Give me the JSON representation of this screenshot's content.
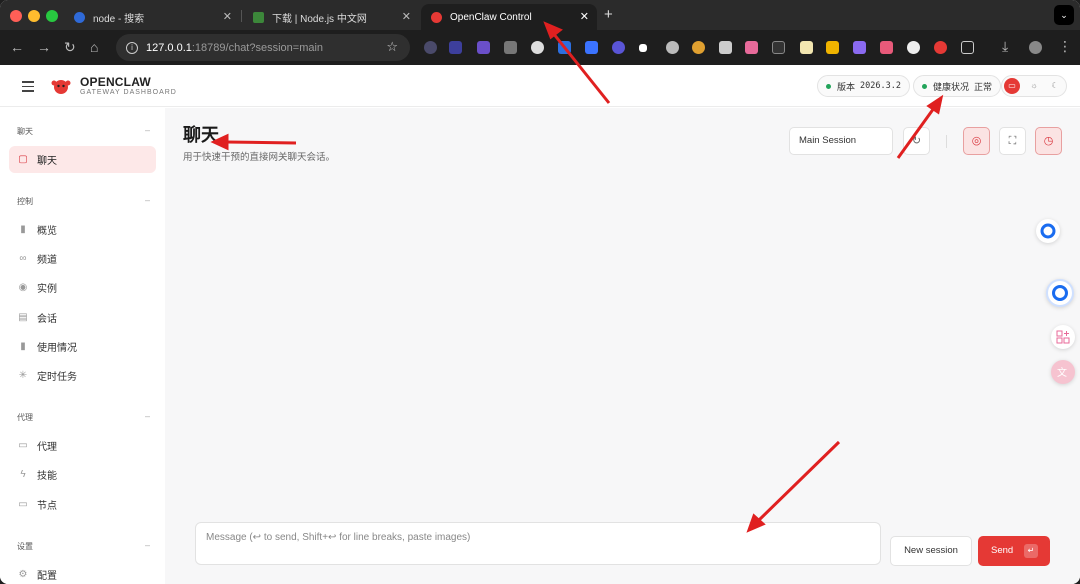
{
  "browser": {
    "tabs": [
      {
        "title": "node - 搜索"
      },
      {
        "title": "下载 | Node.js 中文网"
      },
      {
        "title": "OpenClaw Control"
      }
    ],
    "address": {
      "host": "127.0.0.1",
      "path": ":18789/chat?session=main"
    }
  },
  "app": {
    "brand": "OPENCLAW",
    "brand_sub": "GATEWAY DASHBOARD",
    "version_label": "版本",
    "version_value": "2026.3.2",
    "health_label": "健康状况",
    "health_value": "正常",
    "accent_color": "#e53935",
    "status_color": "#22a45a"
  },
  "sidebar": {
    "sections": [
      {
        "title": "聊天",
        "items": [
          {
            "label": "聊天",
            "icon": "chat-bubble-icon",
            "active": true
          }
        ]
      },
      {
        "title": "控制",
        "items": [
          {
            "label": "概览",
            "icon": "bar-chart-icon"
          },
          {
            "label": "频道",
            "icon": "link-icon"
          },
          {
            "label": "实例",
            "icon": "broadcast-icon"
          },
          {
            "label": "会话",
            "icon": "document-icon"
          },
          {
            "label": "使用情况",
            "icon": "bar-chart-icon"
          },
          {
            "label": "定时任务",
            "icon": "loader-icon"
          }
        ]
      },
      {
        "title": "代理",
        "items": [
          {
            "label": "代理",
            "icon": "folder-icon"
          },
          {
            "label": "技能",
            "icon": "bolt-icon"
          },
          {
            "label": "节点",
            "icon": "monitor-icon"
          }
        ]
      },
      {
        "title": "设置",
        "items": [
          {
            "label": "配置",
            "icon": "gear-icon"
          }
        ]
      }
    ]
  },
  "main": {
    "title": "聊天",
    "subtitle": "用于快速干预的直接网关聊天会话。",
    "session_value": "Main Session",
    "composer_placeholder": "Message (↩ to send, Shift+↩ for line breaks, paste images)",
    "new_session_label": "New session",
    "send_label": "Send"
  }
}
